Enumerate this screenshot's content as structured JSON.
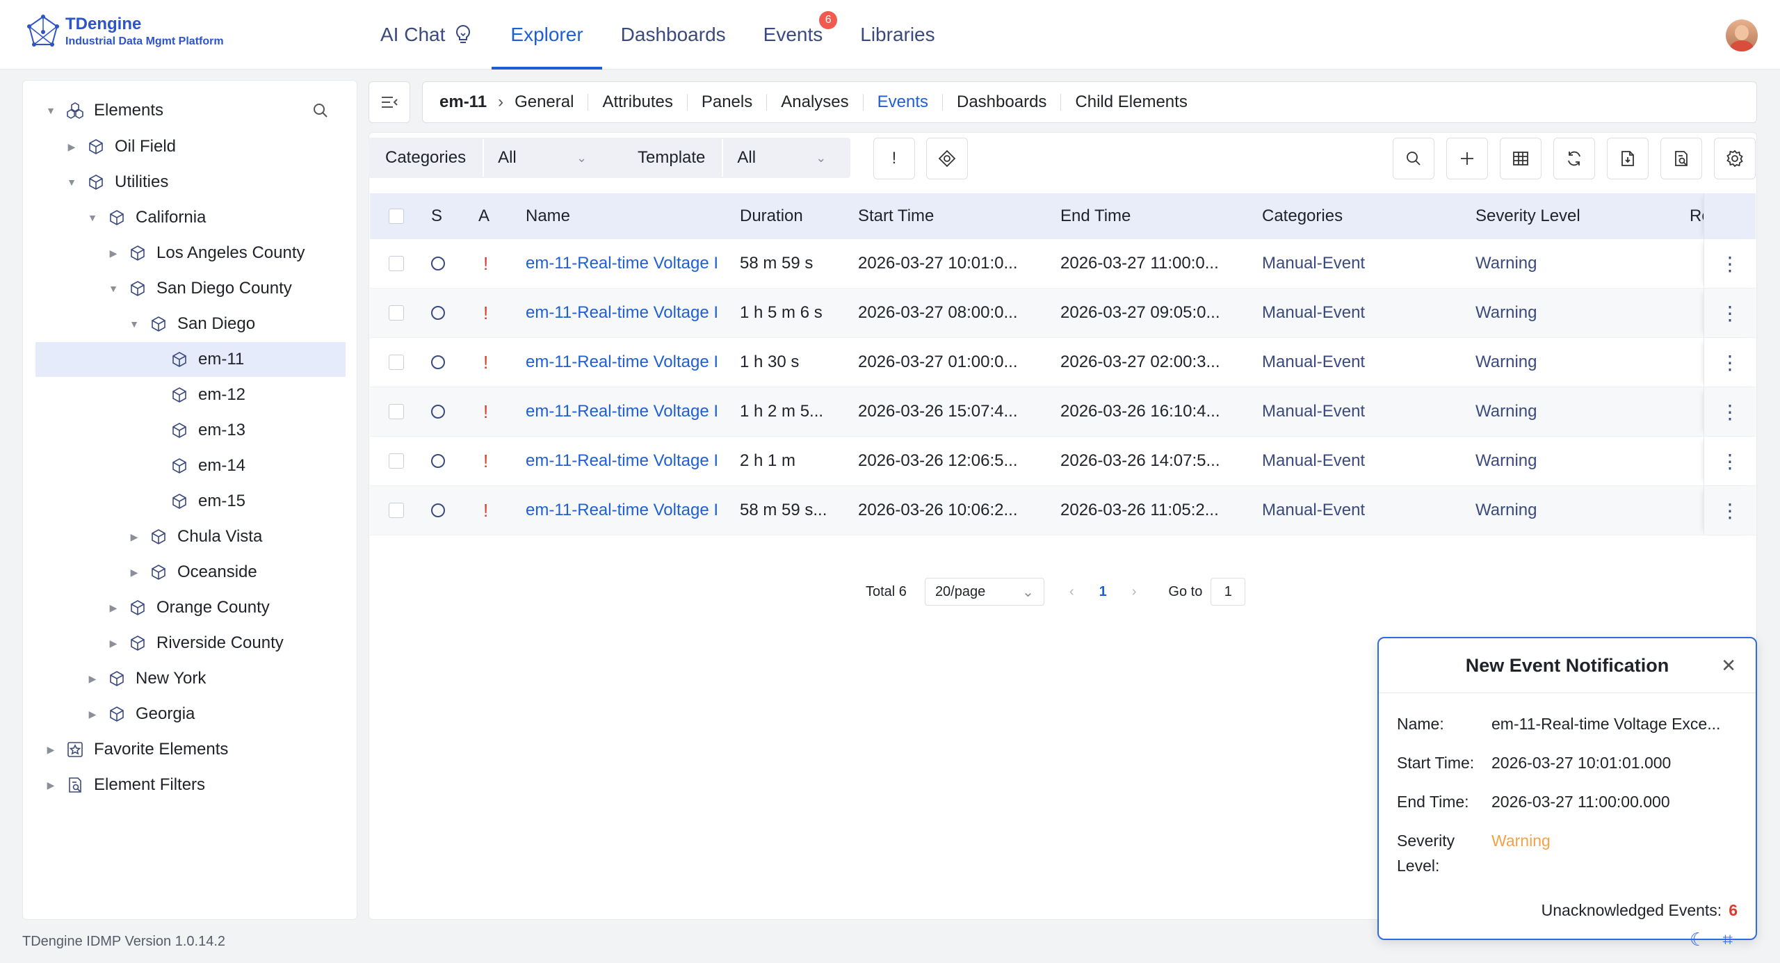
{
  "app": {
    "title": "TDengine",
    "subtitle": "Industrial Data Mgmt Platform",
    "version": "TDengine IDMP Version 1.0.14.2"
  },
  "nav": {
    "items": [
      {
        "label": "AI Chat"
      },
      {
        "label": "Explorer"
      },
      {
        "label": "Dashboards"
      },
      {
        "label": "Events",
        "badge": "6"
      },
      {
        "label": "Libraries"
      }
    ],
    "active": "Explorer"
  },
  "sidebar": {
    "root": "Elements",
    "nodes": [
      {
        "label": "Oil Field"
      },
      {
        "label": "Utilities"
      },
      {
        "label": "California"
      },
      {
        "label": "Los Angeles County"
      },
      {
        "label": "San Diego County"
      },
      {
        "label": "San Diego"
      },
      {
        "label": "em-11"
      },
      {
        "label": "em-12"
      },
      {
        "label": "em-13"
      },
      {
        "label": "em-14"
      },
      {
        "label": "em-15"
      },
      {
        "label": "Chula Vista"
      },
      {
        "label": "Oceanside"
      },
      {
        "label": "Orange County"
      },
      {
        "label": "Riverside County"
      },
      {
        "label": "New York"
      },
      {
        "label": "Georgia"
      },
      {
        "label": "Favorite Elements"
      },
      {
        "label": "Element Filters"
      }
    ]
  },
  "breadcrumb": {
    "root": "em-11",
    "tabs": [
      "General",
      "Attributes",
      "Panels",
      "Analyses",
      "Events",
      "Dashboards",
      "Child Elements"
    ],
    "active": "Events"
  },
  "filters": {
    "categories_label": "Categories",
    "categories_value": "All",
    "template_label": "Template",
    "template_value": "All",
    "exclaim_label": "!"
  },
  "table": {
    "headers": [
      "S",
      "A",
      "Name",
      "Duration",
      "Start Time",
      "End Time",
      "Categories",
      "Severity Level",
      "Re"
    ],
    "rows": [
      [
        "em-11-Real-time Voltage I",
        "58 m 59 s",
        "2026-03-27 10:01:0...",
        "2026-03-27 11:00:0...",
        "Manual-Event",
        "Warning"
      ],
      [
        "em-11-Real-time Voltage I",
        "1 h 5 m 6 s",
        "2026-03-27 08:00:0...",
        "2026-03-27 09:05:0...",
        "Manual-Event",
        "Warning"
      ],
      [
        "em-11-Real-time Voltage I",
        "1 h 30 s",
        "2026-03-27 01:00:0...",
        "2026-03-27 02:00:3...",
        "Manual-Event",
        "Warning"
      ],
      [
        "em-11-Real-time Voltage I",
        "1 h 2 m 5...",
        "2026-03-26 15:07:4...",
        "2026-03-26 16:10:4...",
        "Manual-Event",
        "Warning"
      ],
      [
        "em-11-Real-time Voltage I",
        "2 h 1 m",
        "2026-03-26 12:06:5...",
        "2026-03-26 14:07:5...",
        "Manual-Event",
        "Warning"
      ],
      [
        "em-11-Real-time Voltage I",
        "58 m 59 s...",
        "2026-03-26 10:06:2...",
        "2026-03-26 11:05:2...",
        "Manual-Event",
        "Warning"
      ]
    ],
    "ack_mark": "!"
  },
  "pagination": {
    "total": "Total 6",
    "page_size": "20/page",
    "current_page": "1",
    "goto_label": "Go to",
    "goto_value": "1"
  },
  "notification": {
    "title": "New Event Notification",
    "name_label": "Name:",
    "name_value": "em-11-Real-time Voltage Exce...",
    "start_label": "Start Time:",
    "start_value": "2026-03-27 10:01:01.000",
    "end_label": "End Time:",
    "end_value": "2026-03-27 11:00:00.000",
    "severity_label_1": "Severity",
    "severity_label_2": "Level:",
    "severity_value": "Warning",
    "unack_label": "Unacknowledged Events:",
    "unack_count": "6"
  },
  "colors": {
    "accent": "#1f5fd6",
    "brand": "#2d54c8",
    "danger": "#e0392b",
    "warning": "#f2a24a"
  }
}
